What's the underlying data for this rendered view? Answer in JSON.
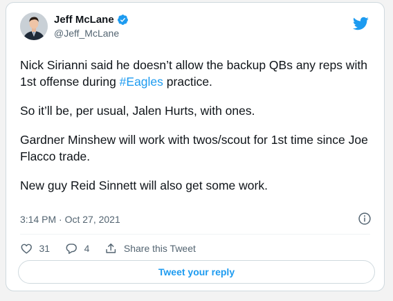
{
  "author": {
    "name": "Jeff McLane",
    "handle": "@Jeff_McLane",
    "verified": true
  },
  "tweet": {
    "p1_before": "Nick Sirianni said he doesn’t allow the backup QBs any reps with 1st offense during ",
    "p1_hashtag": "#Eagles",
    "p1_after": " practice.",
    "p2": "So it’ll be, per usual, Jalen Hurts, with ones.",
    "p3": "Gardner Minshew will work with twos/scout for 1st time since Joe Flacco trade.",
    "p4": "New guy Reid Sinnett will also get some work."
  },
  "meta": {
    "timestamp": "3:14 PM · Oct 27, 2021"
  },
  "actions": {
    "like_count": "31",
    "reply_count": "4",
    "share_label": "Share this Tweet"
  },
  "reply_button": {
    "label": "Tweet your reply"
  },
  "icons": {
    "brand": "twitter-bird-icon",
    "verified": "verified-badge-icon",
    "info": "info-icon",
    "like": "heart-icon",
    "reply": "comment-icon",
    "share": "share-icon"
  },
  "colors": {
    "accent": "#1d9bf0",
    "text": "#0f1419",
    "secondary": "#536471",
    "border": "#cfd9de"
  }
}
